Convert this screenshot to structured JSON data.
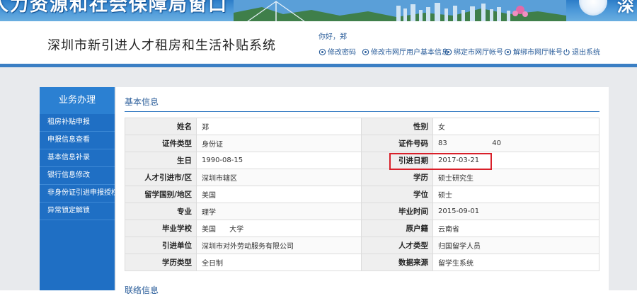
{
  "banner": {
    "title": "人力资源和社会保障局窗口",
    "right_title": "深"
  },
  "header": {
    "system_title": "深圳市新引进人才租房和生活补贴系统",
    "greeting": "你好，郑",
    "links": [
      {
        "label": "修改密码",
        "icon": "gear-icon"
      },
      {
        "label": "修改市网厅用户基本信息",
        "icon": "gear-icon"
      },
      {
        "label": "绑定市网厅帐号",
        "icon": "gear-icon"
      },
      {
        "label": "解绑市网厅帐号",
        "icon": "gear-icon"
      },
      {
        "label": "退出系统",
        "icon": "power-icon"
      }
    ]
  },
  "sidebar": {
    "title": "业务办理",
    "items": [
      {
        "label": "租房补贴申报"
      },
      {
        "label": "申报信息查看"
      },
      {
        "label": "基本信息补录"
      },
      {
        "label": "银行信息修改"
      },
      {
        "label": "非身份证引进申报授权"
      },
      {
        "label": "异常锁定解锁"
      }
    ]
  },
  "main": {
    "section_title": "基本信息",
    "next_section_title": "联络信息",
    "rows": [
      {
        "l1": "姓名",
        "v1": "郑",
        "l2": "性别",
        "v2": "女"
      },
      {
        "l1": "证件类型",
        "v1": "身份证",
        "l2": "证件号码",
        "v2": "83                    40"
      },
      {
        "l1": "生日",
        "v1": "1990-08-15",
        "l2": "引进日期",
        "v2": "2017-03-21"
      },
      {
        "l1": "人才引进市/区",
        "v1": "深圳市辖区",
        "l2": "学历",
        "v2": "硕士研究生"
      },
      {
        "l1": "留学国别/地区",
        "v1": "美国",
        "l2": "学位",
        "v2": "硕士"
      },
      {
        "l1": "专业",
        "v1": "理学",
        "l2": "毕业时间",
        "v2": "2015-09-01"
      },
      {
        "l1": "毕业学校",
        "v1": "美国      大学",
        "l2": "原户籍",
        "v2": "云南省"
      },
      {
        "l1": "引进单位",
        "v1": "深圳市对外劳动服务有限公司",
        "l2": "人才类型",
        "v2": "归国留学人员"
      },
      {
        "l1": "学历类型",
        "v1": "全日制",
        "l2": "数据来源",
        "v2": "留学生系统"
      }
    ]
  },
  "colors": {
    "accent": "#3b7fc4",
    "sidebar": "#1f6fc4",
    "highlight": "#d9202a"
  }
}
